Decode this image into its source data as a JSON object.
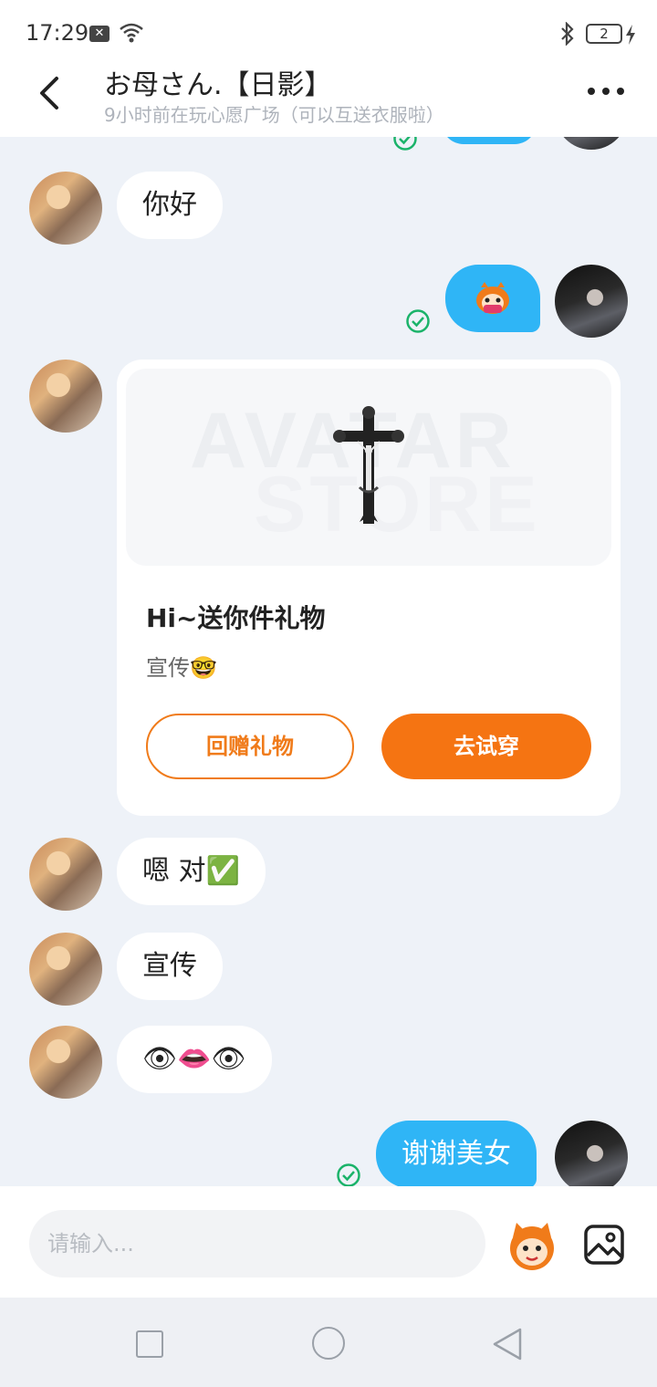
{
  "status_bar": {
    "time": "17:29",
    "notification_badge": "✕",
    "battery_level": "2"
  },
  "header": {
    "title": "お母さん.【日影】",
    "subtitle": "9小时前在玩心愿广场（可以互送衣服啦）"
  },
  "messages": [
    {
      "sender": "other",
      "text": "你好"
    },
    {
      "sender": "self",
      "type": "sticker"
    },
    {
      "sender": "other",
      "type": "gift_card"
    },
    {
      "sender": "other",
      "text": "嗯 对✅"
    },
    {
      "sender": "other",
      "text": "宣传"
    },
    {
      "sender": "other",
      "text": "👁👄👁"
    },
    {
      "sender": "self",
      "text": "谢谢美女"
    }
  ],
  "gift_card": {
    "watermark_line1": "AVATAR",
    "watermark_line2": "STORE",
    "title": "Hi~送你件礼物",
    "description": "宣传🤓",
    "return_gift_label": "回赠礼物",
    "try_on_label": "去试穿"
  },
  "input": {
    "placeholder": "请输入..."
  },
  "colors": {
    "outgoing_bubble": "#2fb5f6",
    "accent_orange": "#f57412",
    "read_receipt_green": "#1bb36a",
    "chat_background": "#eef2f8"
  },
  "icons": {
    "back": "chevron-left-icon",
    "more": "more-dots-icon",
    "emoji": "monkey-emoji-icon",
    "image": "image-icon",
    "read": "check-circle-icon"
  }
}
